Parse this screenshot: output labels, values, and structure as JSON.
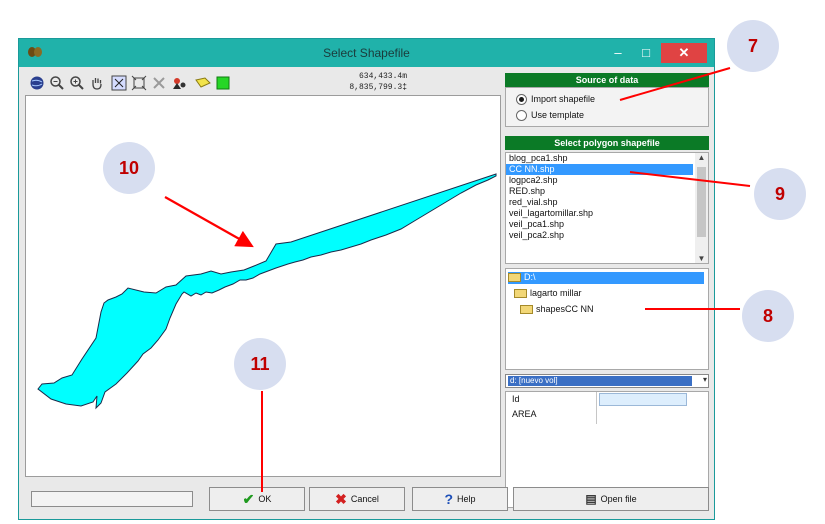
{
  "window": {
    "title": "Select Shapefile",
    "min_glyph": "–",
    "max_glyph": "□",
    "close_glyph": "✕"
  },
  "toolbar": {
    "icons": [
      "globe-icon",
      "zoom-out-icon",
      "zoom-in-icon",
      "pan-hand-icon",
      "zoom-extent-icon",
      "zoom-layer-icon",
      "close-icon",
      "identify-icon",
      "select-icon",
      "green-fill-icon"
    ],
    "coord_x": "634,433.4m",
    "coord_y": "8,835,799.3‡"
  },
  "source": {
    "header": "Source of data",
    "options": [
      {
        "label": "Import shapefile",
        "selected": true
      },
      {
        "label": "Use template",
        "selected": false
      }
    ]
  },
  "polygon_list": {
    "header": "Select polygon shapefile",
    "items": [
      "blog_pca1.shp",
      "CC NN.shp",
      "logpca2.shp",
      "RED.shp",
      "red_vial.shp",
      "veil_lagartomillar.shp",
      "veil_pca1.shp",
      "veil_pca2.shp"
    ],
    "selected_index": 1
  },
  "folders": {
    "drive": "D:\\",
    "folder": "lagarto millar",
    "subfolder": "shapesCC NN"
  },
  "drive_combo": {
    "value": "d: [nuevo vol]"
  },
  "fields": [
    {
      "name": "Id"
    },
    {
      "name": "AREA"
    }
  ],
  "buttons": {
    "ok": "OK",
    "cancel": "Cancel",
    "help": "Help",
    "open": "Open file"
  },
  "callouts": {
    "c7": "7",
    "c8": "8",
    "c9": "9",
    "c10": "10",
    "c11": "11"
  },
  "colors": {
    "titlebar": "#20b2aa",
    "section_header": "#0b7a26",
    "polygon_fill": "#00ffff",
    "callout_bg": "#d7def0",
    "callout_text": "#c00000",
    "arrow": "#ff0000"
  }
}
